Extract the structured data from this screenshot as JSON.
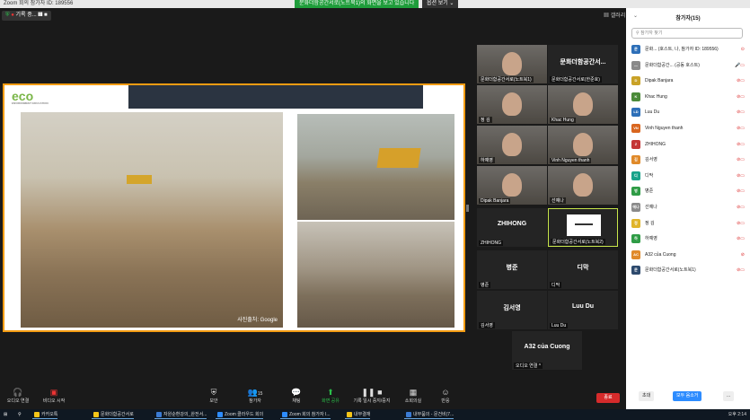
{
  "window": {
    "title": "Zoom 회의 참가자 ID: 189556",
    "share_banner": "문화더함공간서로(노트북1)의 화면을 보고 있습니다",
    "view_options": "옵션 보기 ⌄"
  },
  "recording": {
    "label": "기록 중..."
  },
  "header": {
    "gallery_view": "갤러리 보기"
  },
  "share": {
    "logo": "eco",
    "logo_sub": "ENVIRONMENT EDUCATION",
    "caption": "사진출처: Google"
  },
  "tiles": [
    {
      "name": "문화더함공간서로(노트북1)",
      "type": "video"
    },
    {
      "name": "문화더함공간서로(한준호)",
      "center": "문화더함공간서...",
      "type": "name"
    },
    {
      "name": "정 김",
      "type": "video"
    },
    {
      "name": "Khac Hung",
      "type": "video"
    },
    {
      "name": "하예영",
      "type": "video"
    },
    {
      "name": "Vinh Nguyen thanh",
      "type": "video"
    },
    {
      "name": "Dipak Banjara",
      "type": "video"
    },
    {
      "name": "선예나",
      "type": "video"
    },
    {
      "name": "ZHIHONG",
      "center": "ZHIHONG",
      "type": "name"
    },
    {
      "name": "문화더함공간서로(노트북2)",
      "type": "active"
    },
    {
      "name": "병준",
      "center": "병준",
      "type": "name"
    },
    {
      "name": "디막",
      "center": "디막",
      "type": "name"
    },
    {
      "name": "김서영",
      "center": "김서영",
      "type": "name"
    },
    {
      "name": "Luu Du",
      "center": "Luu Du",
      "type": "name"
    },
    {
      "name": "오디오 연결 ^",
      "center": "A32 của Cuong",
      "type": "name"
    }
  ],
  "panel": {
    "title": "참가자(15)",
    "search_placeholder": "참가자 찾기",
    "participants": [
      {
        "avatar": "문",
        "color": "#2d6fb8",
        "name": "문화... (호스트, 나, 참가자 ID: 189556)",
        "icons": "⊙"
      },
      {
        "avatar": "—",
        "color": "#8a8a8a",
        "name": "문화더함공간... (공동 호스트)",
        "icons": "🎤▭"
      },
      {
        "avatar": "D",
        "color": "#c9a227",
        "name": "Dipak Banjara",
        "icons": "⊘▭"
      },
      {
        "avatar": "K",
        "color": "#4c8b3a",
        "name": "Khac Hung",
        "icons": "⊘▭"
      },
      {
        "avatar": "LD",
        "color": "#2d6fb8",
        "name": "Luu Du",
        "icons": "⊘▭"
      },
      {
        "avatar": "VN",
        "color": "#d9661f",
        "name": "Vinh Nguyen thanh",
        "icons": "⊘▭"
      },
      {
        "avatar": "Z",
        "color": "#c43636",
        "name": "ZHIHONG",
        "icons": "⊘▭"
      },
      {
        "avatar": "김",
        "color": "#e08a2a",
        "name": "김서영",
        "icons": "⊘▭"
      },
      {
        "avatar": "디",
        "color": "#18a38a",
        "name": "디막",
        "icons": "⊘▭"
      },
      {
        "avatar": "병",
        "color": "#2f9c46",
        "name": "병준",
        "icons": "⊘▭"
      },
      {
        "avatar": "에나",
        "color": "#8a8a8a",
        "name": "선예나",
        "icons": "⊘▭"
      },
      {
        "avatar": "정",
        "color": "#e0b42a",
        "name": "정 김",
        "icons": "⊘▭"
      },
      {
        "avatar": "하",
        "color": "#2f9c46",
        "name": "하예영",
        "icons": "⊘▭"
      },
      {
        "avatar": "AC",
        "color": "#e08a2a",
        "name": "A32 của Cuong",
        "icons": "⊘"
      },
      {
        "avatar": "문",
        "color": "#2d4a6d",
        "name": "문화더함공간서로(노트북1)",
        "icons": "⊘▭"
      }
    ],
    "invite": "초대",
    "mute_all": "모두 음소거",
    "more": "..."
  },
  "toolbar": {
    "audio": "오디오 연결",
    "video": "비디오 시작",
    "security": "보안",
    "participants": "참가자",
    "participants_count": "15",
    "chat": "채팅",
    "share": "화면 공유",
    "record": "기록 일시 중지/중지",
    "rooms": "소회의실",
    "reactions": "반응",
    "end": "종료"
  },
  "taskbar": {
    "items": [
      "카카오톡",
      "문화더함공간서로",
      "자원순환강의_완전서...",
      "Zoom 클라우드 회의",
      "Zoom 회의 참가자 I...",
      "내부결재",
      "내부품의 - 문건비(7..."
    ],
    "clock": "오후 2:14"
  }
}
